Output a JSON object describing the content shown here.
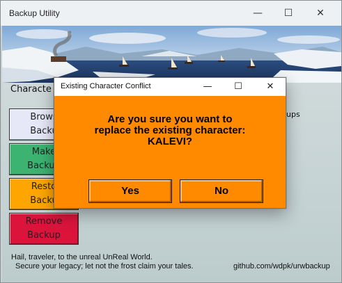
{
  "window": {
    "title": "Backup Utility",
    "controls": {
      "minimize": "—",
      "maximize": "☐",
      "close": "✕"
    }
  },
  "main": {
    "section_label": "Characte",
    "backups_label": "ups",
    "buttons": [
      {
        "line1": "Brows",
        "line2": "Backu",
        "color": "#e6e8f8"
      },
      {
        "line1": "Make",
        "line2": "Backup",
        "color": "#3cb371"
      },
      {
        "line1": "Resto",
        "line2": "Backu",
        "color": "#ffa500"
      },
      {
        "line1": "Remove",
        "line2": "Backup",
        "color": "#dc143c"
      }
    ],
    "footer": {
      "line1": "Hail, traveler, to the unreal UnReal World.",
      "line2": "Secure your legacy; let not the frost claim your tales.",
      "link": "github.com/wdpk/urwbackup"
    }
  },
  "dialog": {
    "title": "Existing Character Conflict",
    "controls": {
      "minimize": "—",
      "maximize": "☐",
      "close": "✕"
    },
    "message_line1": "Are you sure you want to",
    "message_line2": "replace the existing character:",
    "message_line3": "KALEVI?",
    "yes_label": "Yes",
    "no_label": "No",
    "color": "#ff8a00"
  }
}
